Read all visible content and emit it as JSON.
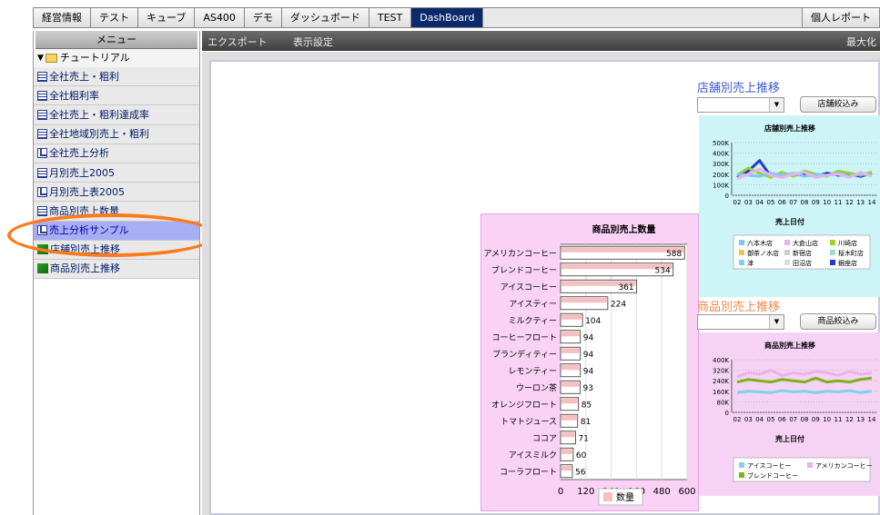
{
  "tabs": [
    {
      "label": "経営情報",
      "active": false
    },
    {
      "label": "テスト",
      "active": false
    },
    {
      "label": "キューブ",
      "active": false
    },
    {
      "label": "AS400",
      "active": false
    },
    {
      "label": "デモ",
      "active": false
    },
    {
      "label": "ダッシュボード",
      "active": false
    },
    {
      "label": "TEST",
      "active": false
    },
    {
      "label": "DashBoard",
      "active": true
    }
  ],
  "personal_report_tab": "個人レポート",
  "sidebar": {
    "header": "メニュー",
    "root": "チュートリアル",
    "items": [
      {
        "label": "全社売上・粗利",
        "icon": "table-icon",
        "selected": false
      },
      {
        "label": "全社粗利率",
        "icon": "table-icon",
        "selected": false
      },
      {
        "label": "全社売上・粗利達成率",
        "icon": "table-icon",
        "selected": false
      },
      {
        "label": "全社地域別売上・粗利",
        "icon": "table-icon",
        "selected": false
      },
      {
        "label": "全社売上分析",
        "icon": "chart-icon",
        "selected": false
      },
      {
        "label": "月別売上2005",
        "icon": "table-icon",
        "selected": false
      },
      {
        "label": "月別売上表2005",
        "icon": "chart-icon",
        "selected": false
      },
      {
        "label": "商品別売上数量",
        "icon": "table-icon",
        "selected": false
      },
      {
        "label": "売上分析サンプル",
        "icon": "chart-icon",
        "selected": true
      },
      {
        "label": "店舗別売上推移",
        "icon": "dashboard-icon",
        "selected": false
      },
      {
        "label": "商品別売上推移",
        "icon": "dashboard-icon",
        "selected": false
      }
    ]
  },
  "toolbar": {
    "export": "エクスポート",
    "display_settings": "表示設定",
    "maximize": "最大化"
  },
  "store_panel": {
    "title": "店舗別売上推移",
    "filter_button": "店舗絞込み",
    "chart_title": "店舗別売上推移",
    "xlabel": "売上日付",
    "legend": [
      "六本木店",
      "大倉山店",
      "川崎店",
      "御茶ノ水店",
      "新宿店",
      "桜木町店",
      "津",
      "田沼店",
      "銀座店"
    ],
    "legend_colors": [
      "#7fc9f0",
      "#e6b3ea",
      "#9bd12a",
      "#f2c14e",
      "#cfcfcf",
      "#9fe0c0",
      "#7fd0ff",
      "#dddddd",
      "#2438d6"
    ]
  },
  "product_panel": {
    "title": "商品別売上推移",
    "filter_button": "商品絞込み",
    "chart_title": "商品別売上推移",
    "xlabel": "売上日付",
    "legend": [
      "アイスコーヒー",
      "アメリカンコーヒー",
      "ブレンドコーヒー"
    ],
    "legend_colors": [
      "#7fd3ea",
      "#e6b3ea",
      "#79b41a"
    ]
  },
  "chart_data": [
    {
      "type": "bar",
      "orientation": "horizontal",
      "title": "商品別売上数量",
      "categories": [
        "アメリカンコーヒー",
        "ブレンドコーヒー",
        "アイスコーヒー",
        "アイスティー",
        "ミルクティー",
        "コーヒーフロート",
        "ブランディティー",
        "レモンティー",
        "ウーロン茶",
        "オレンジフロート",
        "トマトジュース",
        "ココア",
        "アイスミルク",
        "コーラフロート"
      ],
      "series": [
        {
          "name": "数量",
          "values": [
            588,
            534,
            361,
            224,
            104,
            94,
            94,
            94,
            93,
            85,
            81,
            71,
            60,
            56
          ]
        }
      ],
      "xlim": [
        0,
        600
      ],
      "xticks": [
        0,
        120,
        240,
        360,
        480,
        600
      ],
      "bar_color": "#f6c0c0"
    },
    {
      "type": "line",
      "title": "店舗別売上推移",
      "xlabel": "売上日付",
      "x": [
        "02",
        "03",
        "04",
        "05",
        "06",
        "07",
        "08",
        "09",
        "10",
        "11",
        "12",
        "13",
        "14"
      ],
      "yticks": [
        "0",
        "100K",
        "200K",
        "300K",
        "400K",
        "500K"
      ],
      "ylim": [
        0,
        500000
      ],
      "series": [
        {
          "name": "銀座店",
          "values": [
            170000,
            230000,
            330000,
            180000,
            210000,
            190000,
            200000,
            180000,
            210000,
            190000,
            200000,
            180000,
            210000
          ]
        },
        {
          "name": "川崎店",
          "values": [
            190000,
            260000,
            210000,
            170000,
            220000,
            180000,
            230000,
            200000,
            180000,
            230000,
            210000,
            190000,
            220000
          ]
        },
        {
          "name": "六本木店",
          "values": [
            200000,
            190000,
            180000,
            210000,
            190000,
            210000,
            180000,
            200000,
            190000,
            210000,
            180000,
            200000,
            190000
          ]
        },
        {
          "name": "大倉山店",
          "values": [
            160000,
            200000,
            250000,
            190000,
            170000,
            200000,
            220000,
            170000,
            190000,
            200000,
            170000,
            220000,
            180000
          ]
        }
      ]
    },
    {
      "type": "line",
      "title": "商品別売上推移",
      "xlabel": "売上日付",
      "x": [
        "02",
        "03",
        "04",
        "05",
        "06",
        "07",
        "08",
        "09",
        "10",
        "11",
        "12",
        "13",
        "14"
      ],
      "yticks": [
        "0",
        "80K",
        "160K",
        "240K",
        "320K",
        "400K"
      ],
      "ylim": [
        0,
        400000
      ],
      "series": [
        {
          "name": "アメリカンコーヒー",
          "values": [
            270000,
            300000,
            290000,
            320000,
            280000,
            300000,
            290000,
            310000,
            300000,
            280000,
            310000,
            290000,
            300000
          ]
        },
        {
          "name": "ブレンドコーヒー",
          "values": [
            230000,
            250000,
            240000,
            230000,
            250000,
            240000,
            230000,
            260000,
            230000,
            240000,
            230000,
            250000,
            260000
          ]
        },
        {
          "name": "アイスコーヒー",
          "values": [
            150000,
            160000,
            155000,
            150000,
            165000,
            155000,
            160000,
            150000,
            160000,
            155000,
            165000,
            150000,
            160000
          ]
        }
      ]
    }
  ]
}
